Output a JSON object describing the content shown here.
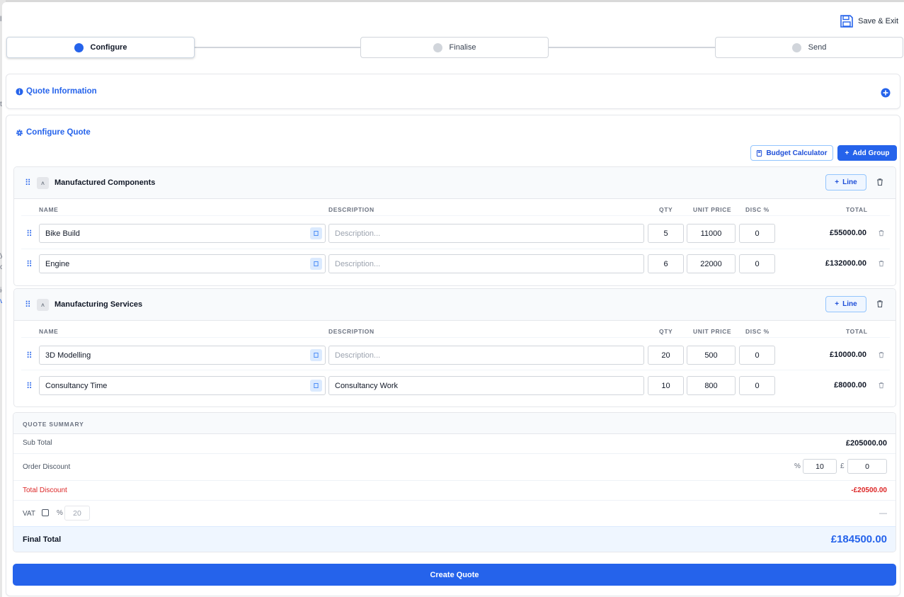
{
  "backdrop": {
    "frag1": "ll",
    "frag2": "t",
    "frag3": "y",
    "frag4": "o",
    "frag5": "ic",
    "frag6": "v"
  },
  "header": {
    "save_exit_label": "Save & Exit"
  },
  "steps": [
    {
      "label": "Configure",
      "active": true
    },
    {
      "label": "Finalise",
      "active": false
    },
    {
      "label": "Send",
      "active": false
    }
  ],
  "quote_info": {
    "title": "Quote Information"
  },
  "configure": {
    "title": "Configure Quote",
    "budget_calculator_label": "Budget Calculator",
    "add_group_label": "Add Group"
  },
  "columns": {
    "name": "NAME",
    "description": "DESCRIPTION",
    "qty": "QTY",
    "unit_price": "UNIT PRICE",
    "disc": "DISC %",
    "total": "TOTAL"
  },
  "description_placeholder": "Description...",
  "line_button_label": "Line",
  "groups": [
    {
      "name": "Manufactured Components",
      "lines": [
        {
          "name": "Bike Build",
          "description": "",
          "qty": "5",
          "unit_price": "11000",
          "disc": "0",
          "total": "£55000.00"
        },
        {
          "name": "Engine",
          "description": "",
          "qty": "6",
          "unit_price": "22000",
          "disc": "0",
          "total": "£132000.00"
        }
      ]
    },
    {
      "name": "Manufacturing Services",
      "lines": [
        {
          "name": "3D Modelling",
          "description": "",
          "qty": "20",
          "unit_price": "500",
          "disc": "0",
          "total": "£10000.00"
        },
        {
          "name": "Consultancy Time",
          "description": "Consultancy Work",
          "qty": "10",
          "unit_price": "800",
          "disc": "0",
          "total": "£8000.00"
        }
      ]
    }
  ],
  "summary": {
    "title": "QUOTE SUMMARY",
    "sub_total_label": "Sub Total",
    "sub_total_value": "£205000.00",
    "order_discount_label": "Order Discount",
    "percent_symbol": "%",
    "pound_symbol": "£",
    "discount_percent": "10",
    "discount_amount": "0",
    "total_discount_label": "Total Discount",
    "total_discount_value": "-£20500.00",
    "vat_label": "VAT",
    "vat_percent_symbol": "%",
    "vat_rate": "20",
    "vat_value": "—",
    "final_total_label": "Final Total",
    "final_total_value": "£184500.00"
  },
  "create_quote_label": "Create Quote",
  "colors": {
    "accent": "#2563eb",
    "danger": "#dc2626"
  }
}
